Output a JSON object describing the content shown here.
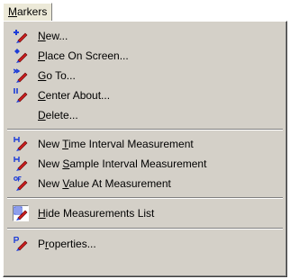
{
  "menubar": {
    "title_prefix": "",
    "title_mnemonic": "M",
    "title_rest": "arkers"
  },
  "menu": {
    "new": {
      "pre": "",
      "mn": "N",
      "post": "ew...",
      "icon": "marker-new-icon"
    },
    "place_on_screen": {
      "pre": "",
      "mn": "P",
      "post": "lace On Screen...",
      "icon": "marker-place-icon"
    },
    "go_to": {
      "pre": "",
      "mn": "G",
      "post": "o To...",
      "icon": "marker-goto-icon"
    },
    "center_about": {
      "pre": "",
      "mn": "C",
      "post": "enter About...",
      "icon": "marker-center-icon"
    },
    "delete": {
      "pre": "",
      "mn": "D",
      "post": "elete..."
    },
    "time_interval": {
      "pre": "New ",
      "mn": "T",
      "post": "ime Interval Measurement",
      "icon": "time-interval-icon"
    },
    "sample_interval": {
      "pre": "New ",
      "mn": "S",
      "post": "ample Interval Measurement",
      "icon": "sample-interval-icon"
    },
    "value_at": {
      "pre": "New ",
      "mn": "V",
      "post": "alue At Measurement",
      "icon": "value-at-icon"
    },
    "hide_list": {
      "pre": "",
      "mn": "H",
      "post": "ide Measurements List",
      "icon": "measurements-list-icon",
      "checked": true
    },
    "properties": {
      "pre": "P",
      "mn": "r",
      "post": "operties...",
      "icon": "properties-icon"
    }
  },
  "colors": {
    "menu_bg": "#d4d0c8",
    "pencil": "#c81e1e",
    "pencil_tip": "#000080",
    "accent_blue": "#1c3cd8"
  }
}
